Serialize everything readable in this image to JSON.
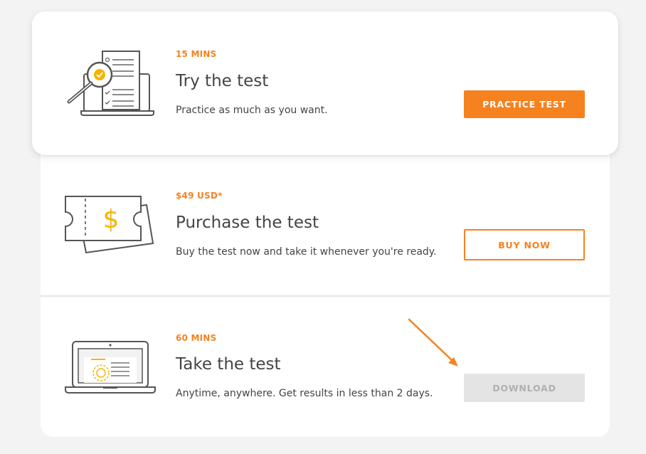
{
  "colors": {
    "accent": "#f5821f",
    "icon_yellow": "#f5b400",
    "text": "#444444",
    "disabled_bg": "#e4e4e4",
    "disabled_text": "#b0b0b0"
  },
  "steps": [
    {
      "eyebrow": "15 MINS",
      "title": "Try the test",
      "description": "Practice as much as you want.",
      "button_label": "PRACTICE TEST",
      "icon": "laptop-magnifier-checklist-icon"
    },
    {
      "eyebrow": "$49 USD*",
      "title": "Purchase the test",
      "description": "Buy the test now and take it whenever you're ready.",
      "button_label": "BUY NOW",
      "icon": "ticket-dollar-icon"
    },
    {
      "eyebrow": "60 MINS",
      "title": "Take the test",
      "description": "Anytime, anywhere. Get results in less than 2 days.",
      "button_label": "DOWNLOAD",
      "button_disabled": true,
      "icon": "laptop-certificate-icon"
    }
  ],
  "annotation": {
    "icon": "orange-arrow-pointer-icon"
  }
}
